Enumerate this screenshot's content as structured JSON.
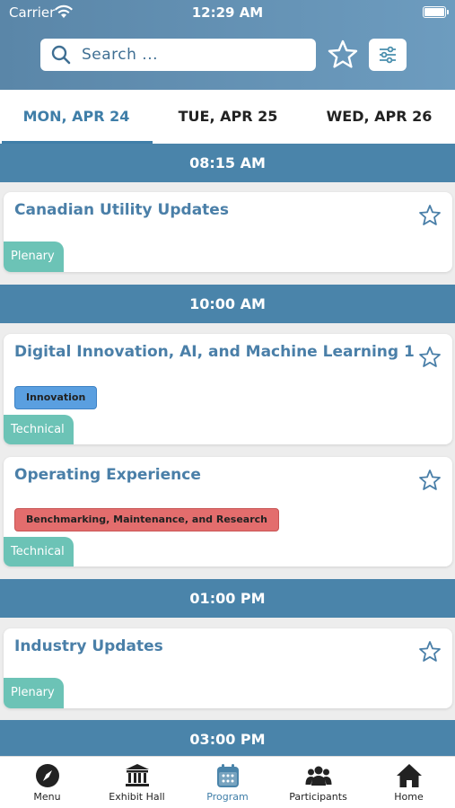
{
  "status": {
    "carrier": "Carrier",
    "time": "12:29 AM"
  },
  "search": {
    "placeholder": "Search ..."
  },
  "days": [
    {
      "label": "MON, APR 24",
      "active": true
    },
    {
      "label": "TUE, APR 25",
      "active": false
    },
    {
      "label": "WED, APR 26",
      "active": false
    }
  ],
  "schedule": [
    {
      "time": "08:15 AM",
      "sessions": [
        {
          "title": "Canadian Utility Updates",
          "track": "Plenary",
          "topics": []
        }
      ]
    },
    {
      "time": "10:00 AM",
      "sessions": [
        {
          "title": "Digital Innovation, AI, and Machine Learning 1",
          "track": "Technical",
          "topics": [
            {
              "label": "Innovation",
              "color": "#5a9fe0"
            }
          ]
        },
        {
          "title": "Operating Experience",
          "track": "Technical",
          "topics": [
            {
              "label": "Benchmarking, Maintenance, and Research",
              "color": "#e36d6d"
            }
          ]
        }
      ]
    },
    {
      "time": "01:00 PM",
      "sessions": [
        {
          "title": "Industry Updates",
          "track": "Plenary",
          "topics": []
        }
      ]
    },
    {
      "time": "03:00 PM",
      "sessions": []
    }
  ],
  "tabbar": [
    {
      "label": "Menu",
      "icon": "compass-icon"
    },
    {
      "label": "Exhibit Hall",
      "icon": "building-icon"
    },
    {
      "label": "Program",
      "icon": "calendar-icon",
      "active": true
    },
    {
      "label": "Participants",
      "icon": "people-icon"
    },
    {
      "label": "Home",
      "icon": "home-icon"
    }
  ],
  "colors": {
    "header": "#5a86a8",
    "accent": "#3f7ea8",
    "timebar": "#4a84aa",
    "track": "#6cc3b6"
  }
}
